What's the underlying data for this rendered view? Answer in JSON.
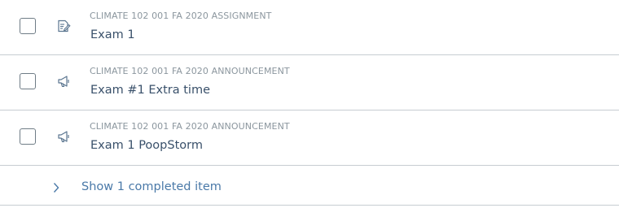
{
  "items": [
    {
      "context": "CLIMATE 102 001 FA 2020 ASSIGNMENT",
      "title": "Exam 1",
      "icon": "assignment-icon"
    },
    {
      "context": "CLIMATE 102 001 FA 2020 ANNOUNCEMENT",
      "title": "Exam #1 Extra time",
      "icon": "announcement-icon"
    },
    {
      "context": "CLIMATE 102 001 FA 2020 ANNOUNCEMENT",
      "title": "Exam 1 PoopStorm",
      "icon": "announcement-icon"
    }
  ],
  "completed_toggle": {
    "label": "Show 1 completed item",
    "icon": "chevron-right-icon"
  },
  "colors": {
    "link": "#4a79a8",
    "title": "#39506a",
    "context": "#8b969e",
    "divider": "#c7cdd1"
  }
}
